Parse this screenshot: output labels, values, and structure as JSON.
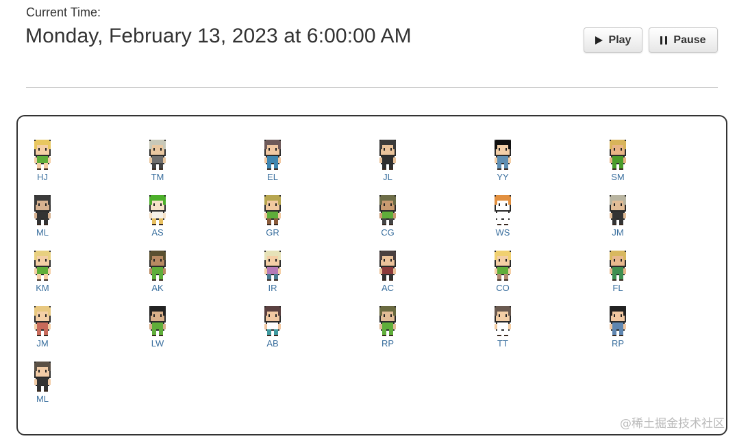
{
  "header": {
    "time_label": "Current Time:",
    "time_value": "Monday, February 13, 2023 at 6:00:00 AM"
  },
  "controls": {
    "play_label": "Play",
    "pause_label": "Pause",
    "play_icon": "play-icon",
    "pause_icon": "pause-icon"
  },
  "agents": [
    {
      "initials": "HJ",
      "hair": "#e8c760",
      "skin": "#f4cfa6",
      "shirt": "#5fae3a",
      "pants": "#f4cfa6"
    },
    {
      "initials": "TM",
      "hair": "#c8c8b8",
      "skin": "#e9c7a0",
      "shirt": "#6e6e6e",
      "pants": "#444444"
    },
    {
      "initials": "EL",
      "hair": "#6e5a5a",
      "skin": "#f1c8a2",
      "shirt": "#3f86b0",
      "pants": "#3f86b0"
    },
    {
      "initials": "JL",
      "hair": "#3a3a3a",
      "skin": "#e9c29a",
      "shirt": "#2e2e2e",
      "pants": "#2e2e2e"
    },
    {
      "initials": "YY",
      "hair": "#111111",
      "skin": "#f3cfa8",
      "shirt": "#5f8fb3",
      "pants": "#5f8fb3"
    },
    {
      "initials": "SM",
      "hair": "#d8b45a",
      "skin": "#e8b486",
      "shirt": "#4a9c2a",
      "pants": "#4a9c2a"
    },
    {
      "initials": "ML",
      "hair": "#3a3a3a",
      "skin": "#d6b190",
      "shirt": "#333333",
      "pants": "#333333"
    },
    {
      "initials": "AS",
      "hair": "#4caf2a",
      "skin": "#f6e2c8",
      "shirt": "#f4f0e8",
      "pants": "#e8c060"
    },
    {
      "initials": "GR",
      "hair": "#b7a650",
      "skin": "#f1c9a0",
      "shirt": "#5fae3a",
      "pants": "#8a5a3a"
    },
    {
      "initials": "CG",
      "hair": "#6d6d48",
      "skin": "#c89a70",
      "shirt": "#5fae3a",
      "pants": "#444444"
    },
    {
      "initials": "WS",
      "hair": "#e29040",
      "skin": "#ffffff",
      "shirt": "#ffffff",
      "pants": "#ffffff"
    },
    {
      "initials": "JM",
      "hair": "#b8b4a0",
      "skin": "#e2bc96",
      "shirt": "#333333",
      "pants": "#333333"
    },
    {
      "initials": "KM",
      "hair": "#e8d080",
      "skin": "#f4cfa6",
      "shirt": "#5fae3a",
      "pants": "#f4cfa6"
    },
    {
      "initials": "AK",
      "hair": "#5a5030",
      "skin": "#b88a62",
      "shirt": "#5fae3a",
      "pants": "#5fae3a"
    },
    {
      "initials": "IR",
      "hair": "#e6e2b8",
      "skin": "#f4cfa6",
      "shirt": "#b57ab8",
      "pants": "#4a7a90"
    },
    {
      "initials": "AC",
      "hair": "#4a4040",
      "skin": "#ecc29a",
      "shirt": "#8a3a3a",
      "pants": "#333333"
    },
    {
      "initials": "CO",
      "hair": "#f0d070",
      "skin": "#f4cfa6",
      "shirt": "#5fae3a",
      "pants": "#b08a70"
    },
    {
      "initials": "FL",
      "hair": "#d8b860",
      "skin": "#e8b88e",
      "shirt": "#3f8f50",
      "pants": "#3f8f50"
    },
    {
      "initials": "JM",
      "hair": "#e8c880",
      "skin": "#f4cfa6",
      "shirt": "#c86a5a",
      "pants": "#c86a5a"
    },
    {
      "initials": "LW",
      "hair": "#222222",
      "skin": "#d9b08a",
      "shirt": "#5fae3a",
      "pants": "#5fae3a"
    },
    {
      "initials": "AB",
      "hair": "#5a4040",
      "skin": "#f1c8a2",
      "shirt": "#ffffff",
      "pants": "#3f9aa0"
    },
    {
      "initials": "RP",
      "hair": "#6a6a40",
      "skin": "#e2bc96",
      "shirt": "#5fae3a",
      "pants": "#5fae3a"
    },
    {
      "initials": "TT",
      "hair": "#6a5a50",
      "skin": "#f4cfa6",
      "shirt": "#ffffff",
      "pants": "#ffffff"
    },
    {
      "initials": "RP",
      "hair": "#222222",
      "skin": "#f1c8a2",
      "shirt": "#5f86b0",
      "pants": "#5f86b0"
    },
    {
      "initials": "ML",
      "hair": "#5a5045",
      "skin": "#f1cba6",
      "shirt": "#333333",
      "pants": "#333333"
    }
  ],
  "watermark": "@稀土掘金技术社区"
}
